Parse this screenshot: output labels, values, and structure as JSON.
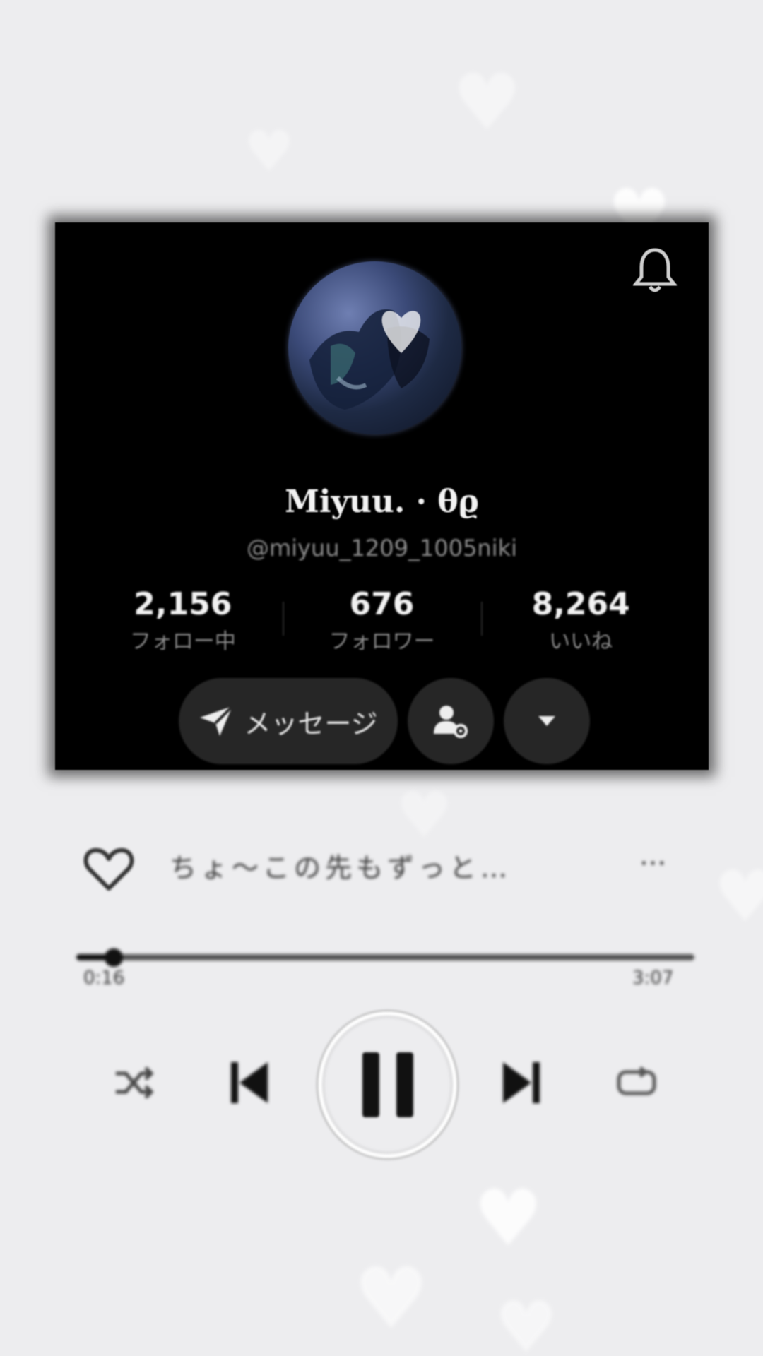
{
  "profile": {
    "display_name": "Miyuu. · θϱ",
    "username": "@miyuu_1209_1005niki",
    "stats": [
      {
        "value": "2,156",
        "label": "フォロー中"
      },
      {
        "value": "676",
        "label": "フォロワー"
      },
      {
        "value": "8,264",
        "label": "いいね"
      }
    ],
    "message_button_label": "メッセージ",
    "icons": {
      "notification": "bell-icon",
      "message": "send-icon",
      "friends": "user-settings-icon",
      "more": "caret-down-icon"
    }
  },
  "player": {
    "lyric": "ちょ〜この先もずっと…",
    "more_label": "···",
    "elapsed": "0:16",
    "duration": "3:07",
    "progress": 0.06,
    "icons": {
      "like": "heart-outline-icon",
      "shuffle": "shuffle-icon",
      "previous": "skip-previous-icon",
      "play_pause": "pause-icon",
      "next": "skip-next-icon",
      "repeat": "repeat-icon"
    }
  },
  "colors": {
    "background": "#ededef",
    "card": "#000000",
    "button": "#262626",
    "text_light": "#f2f2f2",
    "text_muted": "#8a8a8a"
  }
}
